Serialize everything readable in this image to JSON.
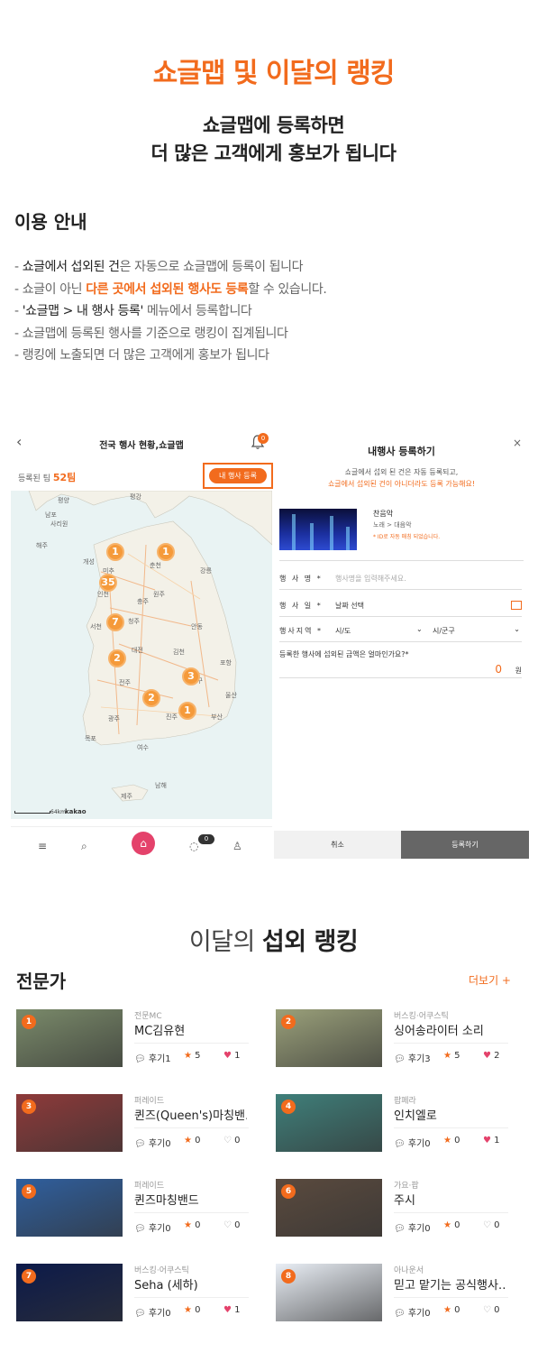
{
  "hero": {
    "title": "쇼글맵 및 이달의 랭킹",
    "sub1": "쇼글맵에 등록하면",
    "sub2": "더 많은 고객에게 홍보가 됩니다"
  },
  "guide": {
    "title": "이용 안내",
    "items": [
      {
        "a": "- ",
        "b": "쇼글에서 섭외된 건",
        "c": "은 자동으로 쇼글맵에 등록이 됩니다",
        "d": ""
      },
      {
        "a": "- 쇼글이 아닌 ",
        "b": "다른 곳에서 섭외된 행사도 등록",
        "c": "할 수 있습니다.",
        "d": ""
      },
      {
        "a": "- ",
        "b": "'쇼글맵 > 내 행사 등록'",
        "c": " 메뉴에서 등록합니다",
        "d": ""
      },
      {
        "a": "- 쇼글맵에 등록된 행사를 기준으로 랭킹이 집계됩니다",
        "b": "",
        "c": "",
        "d": ""
      },
      {
        "a": "- 랭킹에 노출되면 더 많은 고객에게 홍보가 됩니다",
        "b": "",
        "c": "",
        "d": ""
      }
    ]
  },
  "left_phone": {
    "back": "‹",
    "title": "전국 행사 현황,쇼글맵",
    "bell_badge": "0",
    "count_label": "등록된 팀 ",
    "count_value": "52팀",
    "register_btn": "내 행사 등록",
    "pins": [
      "1",
      "1",
      "35",
      "7",
      "2",
      "3",
      "2",
      "1"
    ],
    "places": [
      "평양",
      "남포",
      "사리원",
      "해주",
      "개성",
      "미추",
      "인천",
      "춘천",
      "강릉",
      "원주",
      "충주",
      "청주",
      "대전",
      "전주",
      "광주",
      "대구",
      "포항",
      "울산",
      "부산",
      "진주",
      "목포",
      "여수",
      "제주",
      "평강",
      "김천",
      "서천",
      "안동",
      "남해"
    ],
    "kakao": "kakao",
    "scale": "64km",
    "chat_badge": "0"
  },
  "right_phone": {
    "title": "내행사 등록하기",
    "close": "×",
    "note1": "쇼글에서 섭외 된 건은 자동 등록되고,",
    "note2": "쇼글에서 섭외된 건이 아니더라도 등록 가능해요!",
    "artist_name": "찬음악",
    "artist_cat": "노래 > 대음악",
    "artist_id": "* ID로 자동 매칭 되었습니다.",
    "event_name_label": "행 사 명 *",
    "event_name_ph": "행사명을 입력해주세요.",
    "event_date_label": "행 사 일 *",
    "event_date_ph": "날짜 선택",
    "region_label": "행사지역 *",
    "region1": "시/도",
    "region2": "시/군구",
    "question": "등록한 행사에 섭외된 금액은 얼마인가요?*",
    "amount": "0",
    "unit": "원",
    "cancel": "취소",
    "submit": "등록하기"
  },
  "ranking": {
    "title_a": "이달의 ",
    "title_b": "섭외 랭킹",
    "category": "전문가",
    "more": "더보기 +",
    "review_prefix": "후기",
    "cards": [
      {
        "rank": "1",
        "cat": "전문MC",
        "name": "MC김유현",
        "reviews": "1",
        "stars": "5",
        "hearts": "1",
        "liked": true,
        "bg": "#7a8a6a"
      },
      {
        "rank": "2",
        "cat": "버스킹·어쿠스틱",
        "name": "싱어송라이터 소리",
        "reviews": "3",
        "stars": "5",
        "hearts": "2",
        "liked": true,
        "bg": "#9aa07a"
      },
      {
        "rank": "3",
        "cat": "퍼레이드",
        "name": "퀸즈(Queen's)마칭밴…",
        "reviews": "0",
        "stars": "0",
        "hearts": "0",
        "liked": false,
        "bg": "#8e3a3a"
      },
      {
        "rank": "4",
        "cat": "팝페라",
        "name": "인치엘로",
        "reviews": "0",
        "stars": "0",
        "hearts": "1",
        "liked": true,
        "bg": "#3f7f7a"
      },
      {
        "rank": "5",
        "cat": "퍼레이드",
        "name": "퀸즈마칭밴드",
        "reviews": "0",
        "stars": "0",
        "hearts": "0",
        "liked": false,
        "bg": "#2f5f9e"
      },
      {
        "rank": "6",
        "cat": "가요·팝",
        "name": "주시",
        "reviews": "0",
        "stars": "0",
        "hearts": "0",
        "liked": false,
        "bg": "#5a4a3e"
      },
      {
        "rank": "7",
        "cat": "버스킹·어쿠스틱",
        "name": "Seha (세하)",
        "reviews": "0",
        "stars": "0",
        "hearts": "1",
        "liked": true,
        "bg": "#0c1a4a"
      },
      {
        "rank": "8",
        "cat": "아나운서",
        "name": "믿고 맡기는 공식행사…",
        "reviews": "0",
        "stars": "0",
        "hearts": "0",
        "liked": false,
        "bg": "#e9eef5"
      }
    ]
  }
}
